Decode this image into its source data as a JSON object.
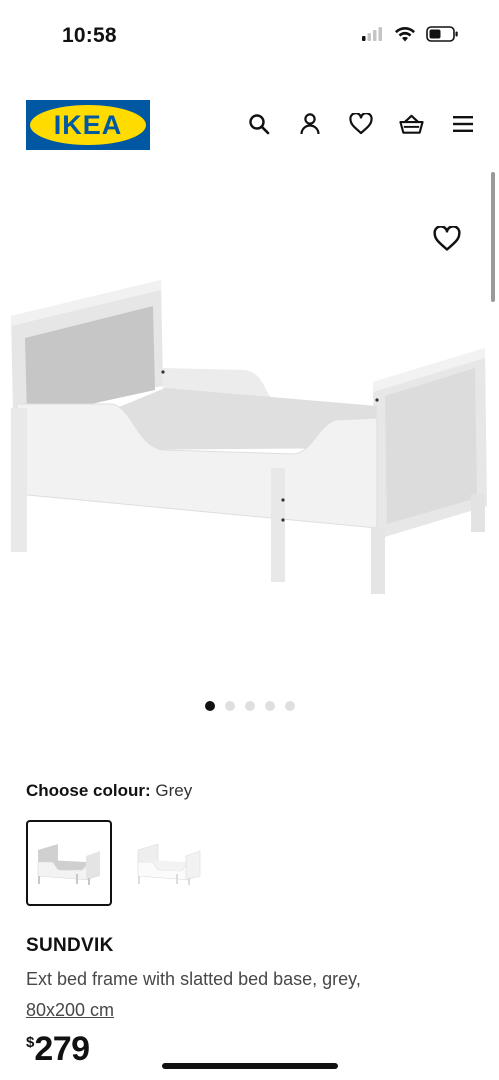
{
  "status_bar": {
    "time": "10:58",
    "icons": [
      "signal-icon",
      "wifi-icon",
      "battery-icon"
    ]
  },
  "header": {
    "logo_text": "IKEA",
    "icons": [
      "search-icon",
      "account-icon",
      "heart-icon",
      "basket-icon",
      "menu-icon"
    ]
  },
  "gallery": {
    "image_count": 5,
    "active_index": 0,
    "favorite_icon": "heart-icon"
  },
  "colour": {
    "label": "Choose colour:",
    "value": "Grey",
    "options": [
      "grey",
      "white"
    ],
    "selected_index": 0
  },
  "product": {
    "name": "SUNDVIK",
    "description": "Ext bed frame with slatted bed base, grey,",
    "dimensions": "80x200 cm",
    "price_currency": "$",
    "price_amount": "279"
  },
  "colors": {
    "ikea_blue": "#0058a3",
    "ikea_yellow": "#ffdb00",
    "text": "#111111"
  }
}
